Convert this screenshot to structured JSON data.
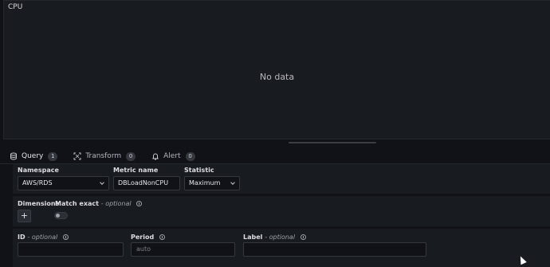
{
  "panel": {
    "title": "CPU",
    "empty_message": "No data"
  },
  "tabs": [
    {
      "label": "Query",
      "count": "1",
      "icon": "database-icon",
      "active": true
    },
    {
      "label": "Transform",
      "count": "0",
      "icon": "transform-icon",
      "active": false
    },
    {
      "label": "Alert",
      "count": "0",
      "icon": "bell-icon",
      "active": false
    }
  ],
  "query": {
    "namespace": {
      "label": "Namespace",
      "value": "AWS/RDS"
    },
    "metric_name": {
      "label": "Metric name",
      "value": "DBLoadNonCPU"
    },
    "statistic": {
      "label": "Statistic",
      "value": "Maximum"
    },
    "dimensions": {
      "label": "Dimensions",
      "add_label": "+"
    },
    "match_exact": {
      "label": "Match exact",
      "optional": "- optional"
    },
    "id": {
      "label": "ID",
      "optional": "- optional",
      "value": ""
    },
    "period": {
      "label": "Period",
      "placeholder": "auto"
    },
    "label": {
      "label": "Label",
      "optional": "- optional",
      "value": ""
    }
  },
  "colors": {
    "accent": "#f55f3e",
    "panel_bg": "#181b1f",
    "page_bg": "#111217"
  }
}
